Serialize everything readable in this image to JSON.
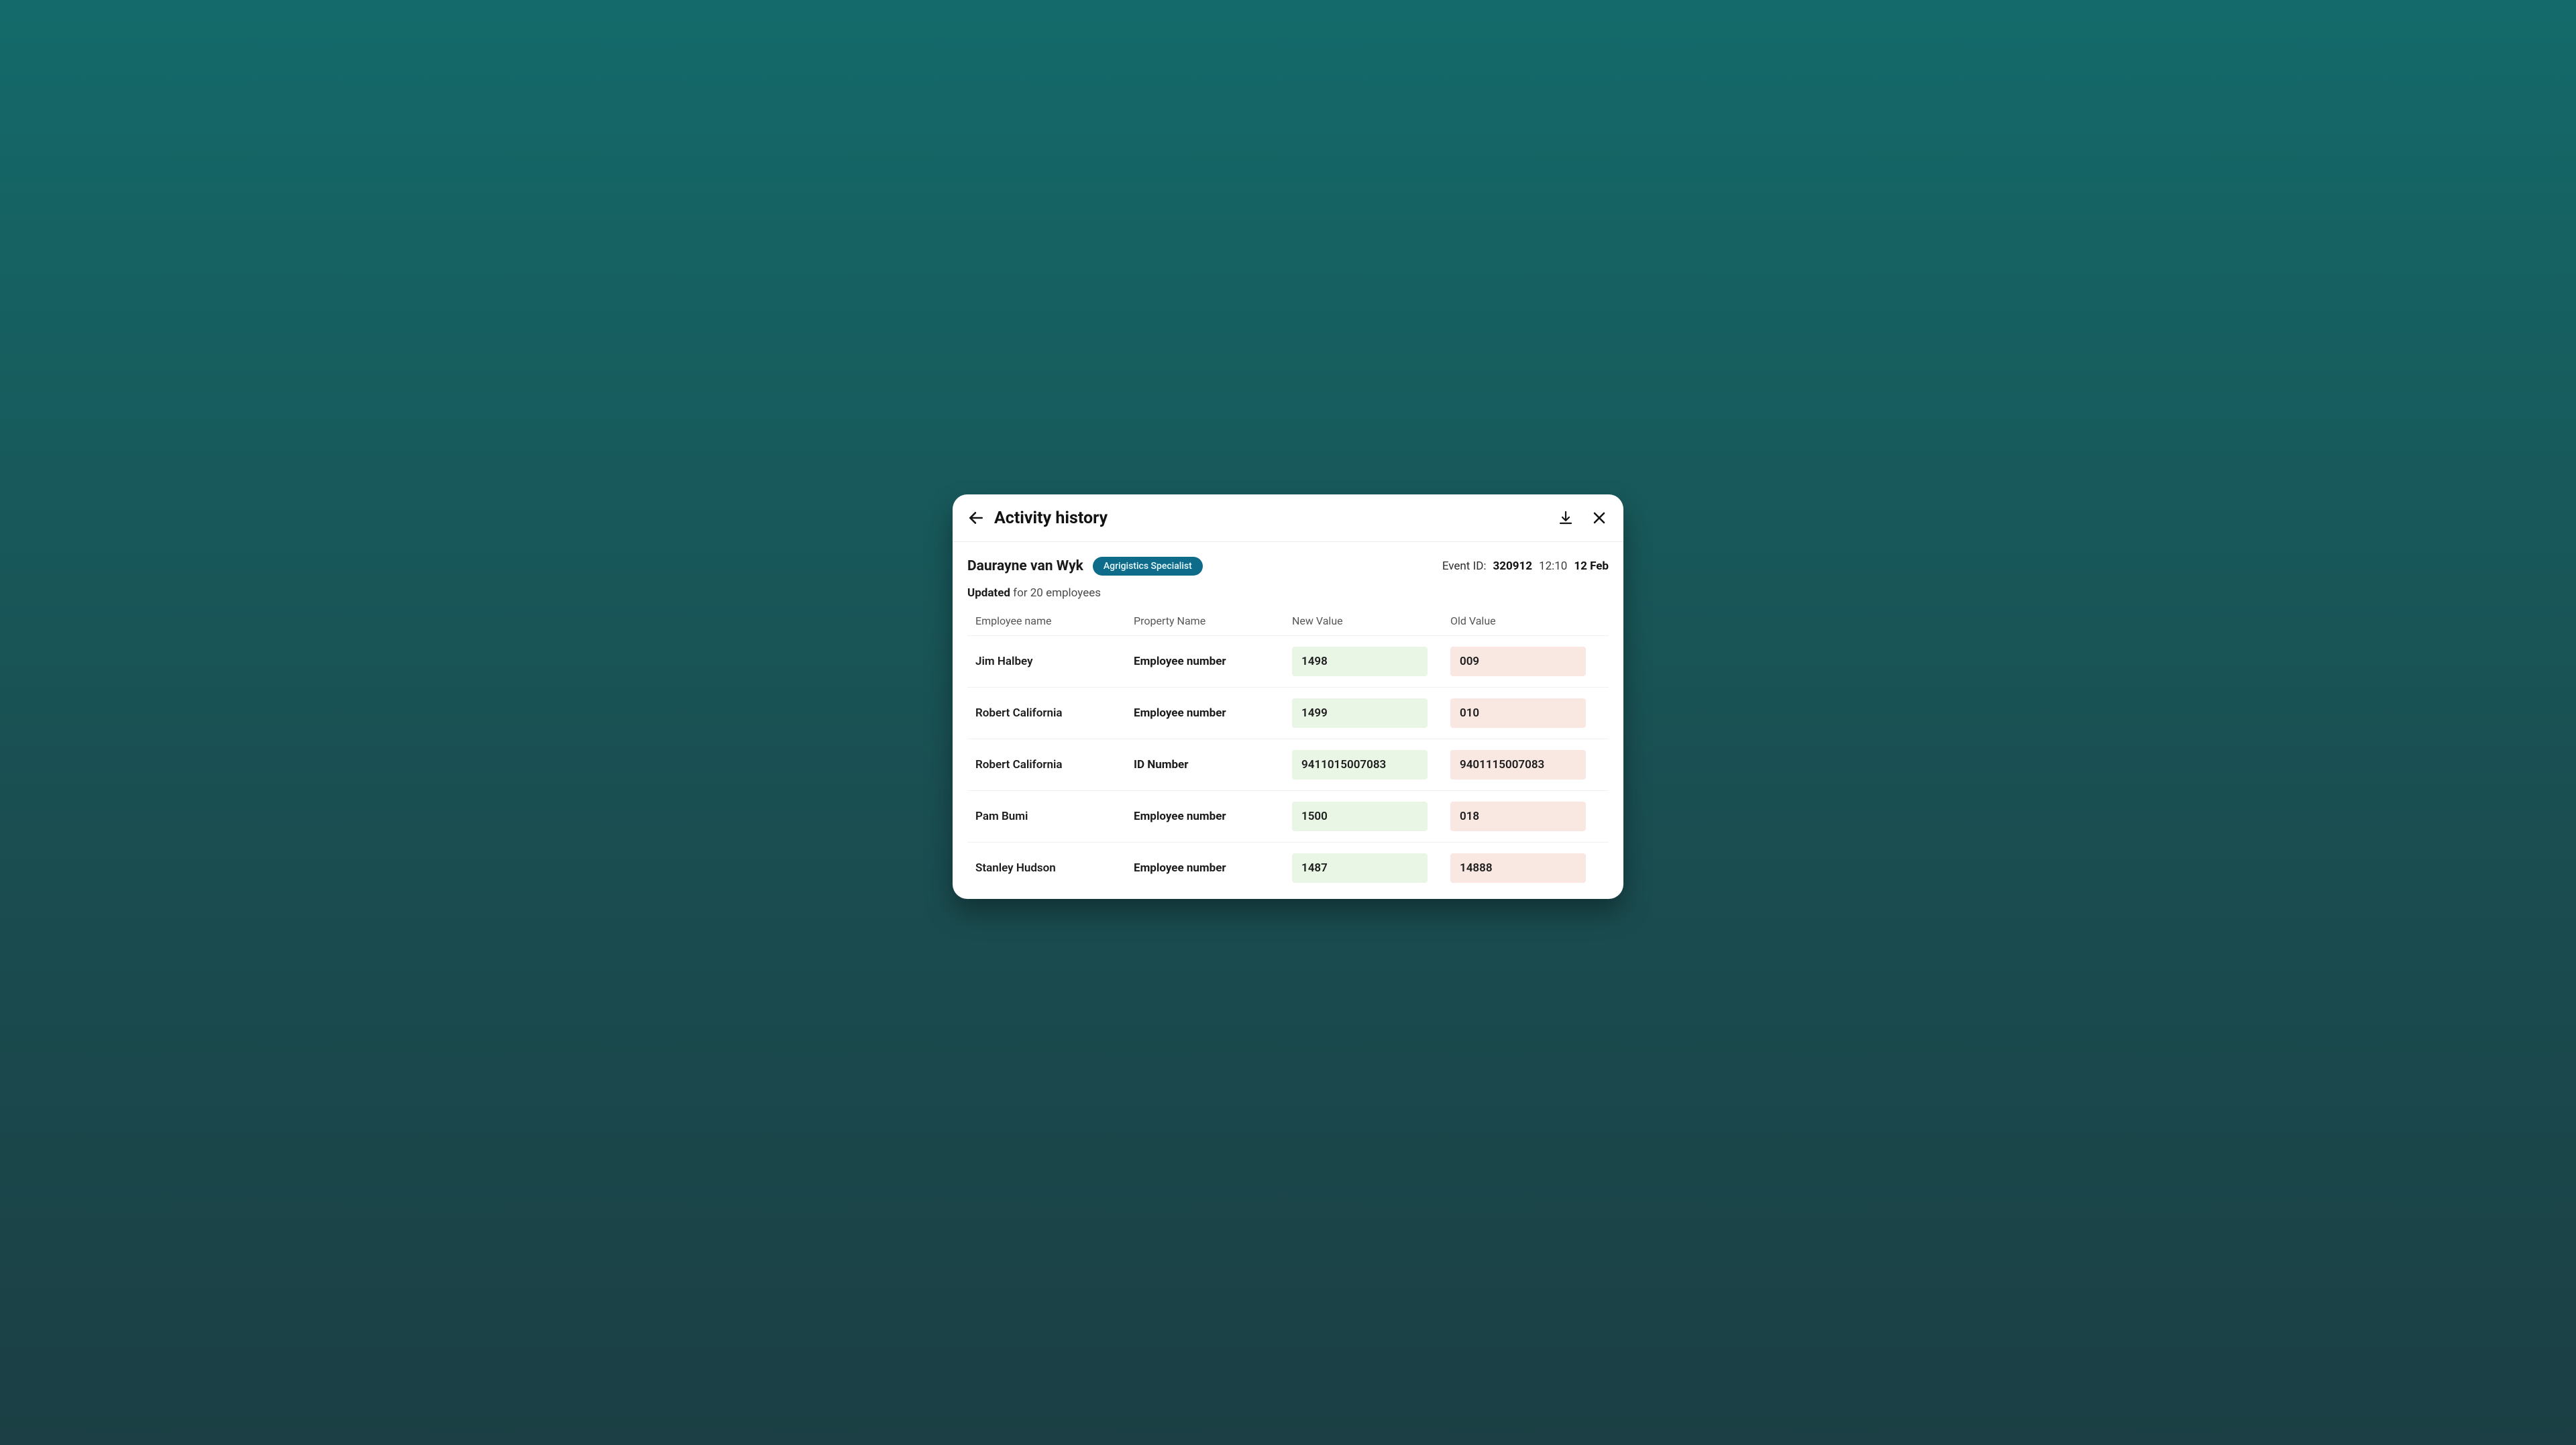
{
  "header": {
    "title": "Activity history"
  },
  "meta": {
    "user_name": "Daurayne van Wyk",
    "role": "Agrigistics Specialist",
    "event_label": "Event ID:",
    "event_id": "320912",
    "time": "12:10",
    "date": "12 Feb"
  },
  "update": {
    "action": "Updated",
    "suffix": "for 20 employees"
  },
  "columns": {
    "employee": "Employee name",
    "property": "Property Name",
    "new": "New Value",
    "old": "Old Value"
  },
  "rows": [
    {
      "employee": "Jim Halbey",
      "property": "Employee number",
      "new": "1498",
      "old": "009"
    },
    {
      "employee": "Robert California",
      "property": "Employee number",
      "new": "1499",
      "old": "010"
    },
    {
      "employee": "Robert California",
      "property": "ID Number",
      "new": "9411015007083",
      "old": "9401115007083"
    },
    {
      "employee": "Pam Bumi",
      "property": "Employee number",
      "new": "1500",
      "old": "018"
    },
    {
      "employee": "Stanley Hudson",
      "property": "Employee number",
      "new": "1487",
      "old": "14888"
    }
  ],
  "colors": {
    "teal_bg_top": "#146a6a",
    "teal_bg_bottom": "#1b3f44",
    "pill_bg": "#0e6b8a",
    "new_bg": "#e9f6e6",
    "old_bg": "#f9e7e1"
  }
}
